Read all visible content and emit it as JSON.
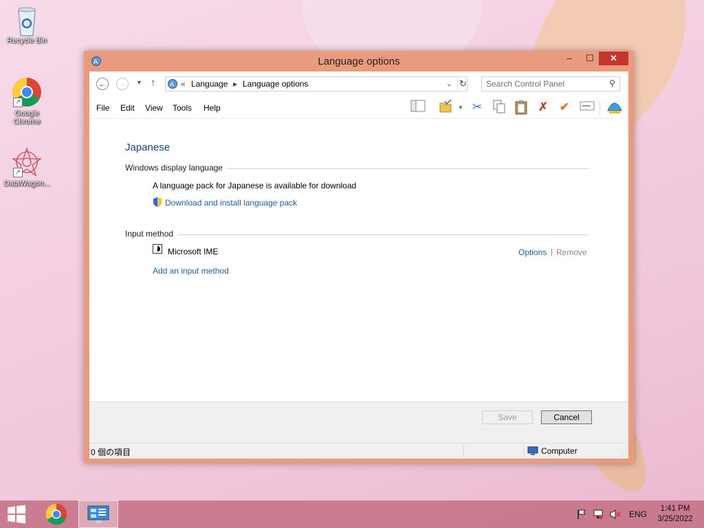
{
  "desktop": {
    "icons": [
      {
        "label": "Recycle Bin"
      },
      {
        "label": "Google Chrome"
      },
      {
        "label": "DataWagon..."
      }
    ]
  },
  "window": {
    "title": "Language options",
    "buttons": {
      "minimize": "–",
      "maximize": "☐",
      "close": "✕"
    },
    "address": {
      "prefix": "«",
      "crumbs": [
        "Language",
        "Language options"
      ]
    },
    "search": {
      "placeholder": "Search Control Panel"
    },
    "menu": [
      "File",
      "Edit",
      "View",
      "Tools",
      "Help"
    ]
  },
  "content": {
    "language_name": "Japanese",
    "display_section": {
      "heading": "Windows display language",
      "message": "A language pack for Japanese is available for download",
      "download_link": "Download and install language pack"
    },
    "input_section": {
      "heading": "Input method",
      "method_name": "Microsoft IME",
      "options_link": "Options",
      "separator": "|",
      "remove_link": "Remove",
      "add_link": "Add an input method"
    }
  },
  "footer": {
    "save_label": "Save",
    "cancel_label": "Cancel"
  },
  "statusbar": {
    "items_text": "0 個の項目",
    "location": "Computer"
  },
  "taskbar": {
    "tray_lang": "ENG",
    "time": "1:41 PM",
    "date": "3/25/2022"
  },
  "colors": {
    "window_frame": "#eb9b7d",
    "close_button": "#c7342b",
    "link": "#1c5fb0",
    "heading": "#1e3f8b"
  }
}
